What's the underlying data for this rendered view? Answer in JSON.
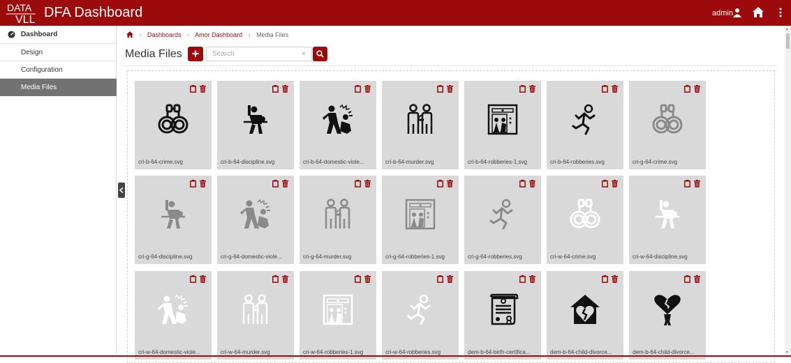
{
  "app": {
    "logo_text": "DATA VLL",
    "title": "DFA Dashboard",
    "user": "admin"
  },
  "sidebar": {
    "header": "Dashboard",
    "items": [
      {
        "label": "Design",
        "active": false
      },
      {
        "label": "Configuration",
        "active": false
      },
      {
        "label": "Media Files",
        "active": true
      }
    ]
  },
  "breadcrumb": [
    "Dashboards",
    "Amor Dashboard",
    "Media Files"
  ],
  "page": {
    "title": "Media Files",
    "search_placeholder": "Search"
  },
  "colors": {
    "brand": "#9c0a0b",
    "tile_bg": "#d9d9d9",
    "icon_black": "#111111",
    "icon_gray": "#8a8a8a",
    "icon_white": "#ffffff"
  },
  "files": [
    {
      "name": "cri-b-64-crime.svg",
      "icon": "handcuffs-icon",
      "tone": "black"
    },
    {
      "name": "cri-b-64-discipline.svg",
      "icon": "discipline-icon",
      "tone": "black"
    },
    {
      "name": "cri-b-64-domestic-viole...",
      "icon": "domestic-violence-icon",
      "tone": "black"
    },
    {
      "name": "cri-b-64-murder.svg",
      "icon": "murder-icon",
      "tone": "black"
    },
    {
      "name": "cri-b-64-robberies-1.svg",
      "icon": "robbery-elevator-icon",
      "tone": "black"
    },
    {
      "name": "cri-b-64-robberies.svg",
      "icon": "running-thief-icon",
      "tone": "black"
    },
    {
      "name": "cri-g-64-crime.svg",
      "icon": "handcuffs-icon",
      "tone": "gray"
    },
    {
      "name": "cri-g-64-discipline.svg",
      "icon": "discipline-icon",
      "tone": "gray"
    },
    {
      "name": "cri-g-64-domestic-viole...",
      "icon": "domestic-violence-icon",
      "tone": "gray"
    },
    {
      "name": "cri-g-64-murder.svg",
      "icon": "murder-icon",
      "tone": "gray"
    },
    {
      "name": "cri-g-64-robberies-1.svg",
      "icon": "robbery-elevator-icon",
      "tone": "gray"
    },
    {
      "name": "cri-g-64-robberies.svg",
      "icon": "running-thief-icon",
      "tone": "gray"
    },
    {
      "name": "cri-w-64-crime.svg",
      "icon": "handcuffs-icon",
      "tone": "white"
    },
    {
      "name": "cri-w-64-discipline.svg",
      "icon": "discipline-icon",
      "tone": "white"
    },
    {
      "name": "cri-w-64-domestic-viole...",
      "icon": "domestic-violence-icon",
      "tone": "white"
    },
    {
      "name": "cri-w-64-murder.svg",
      "icon": "murder-icon",
      "tone": "white"
    },
    {
      "name": "cri-w-64-robberies-1.svg",
      "icon": "robbery-elevator-icon",
      "tone": "white"
    },
    {
      "name": "cri-w-64-robberies.svg",
      "icon": "running-thief-icon",
      "tone": "white"
    },
    {
      "name": "dem-b-64-birth-certifica...",
      "icon": "birth-certificate-icon",
      "tone": "black"
    },
    {
      "name": "dem-b-64-child-divorce...",
      "icon": "broken-heart-house-icon",
      "tone": "black"
    },
    {
      "name": "dem-b-64-child-divorce...",
      "icon": "broken-heart-child-icon",
      "tone": "black"
    }
  ]
}
